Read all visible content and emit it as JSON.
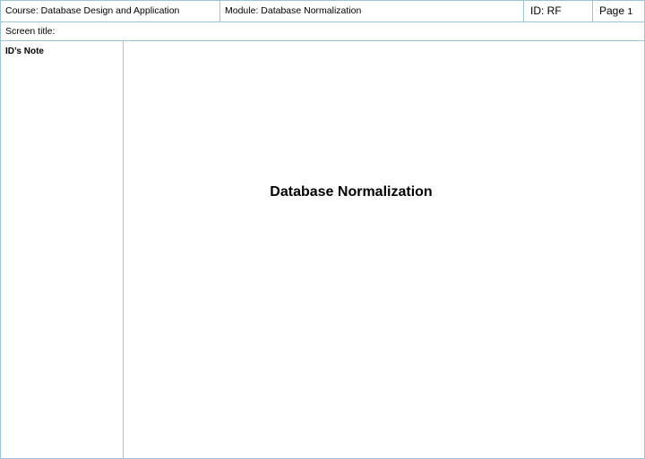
{
  "header": {
    "course": "Course:  Database Design and Application",
    "module": "Module: Database Normalization",
    "id": "ID: RF",
    "page_label": "Page ",
    "page_number": "1"
  },
  "screen_title_label": "Screen title:",
  "notes": {
    "heading": "ID’s Note"
  },
  "main": {
    "title": "Database Normalization"
  },
  "colors": {
    "border": "#9fc3d6"
  }
}
